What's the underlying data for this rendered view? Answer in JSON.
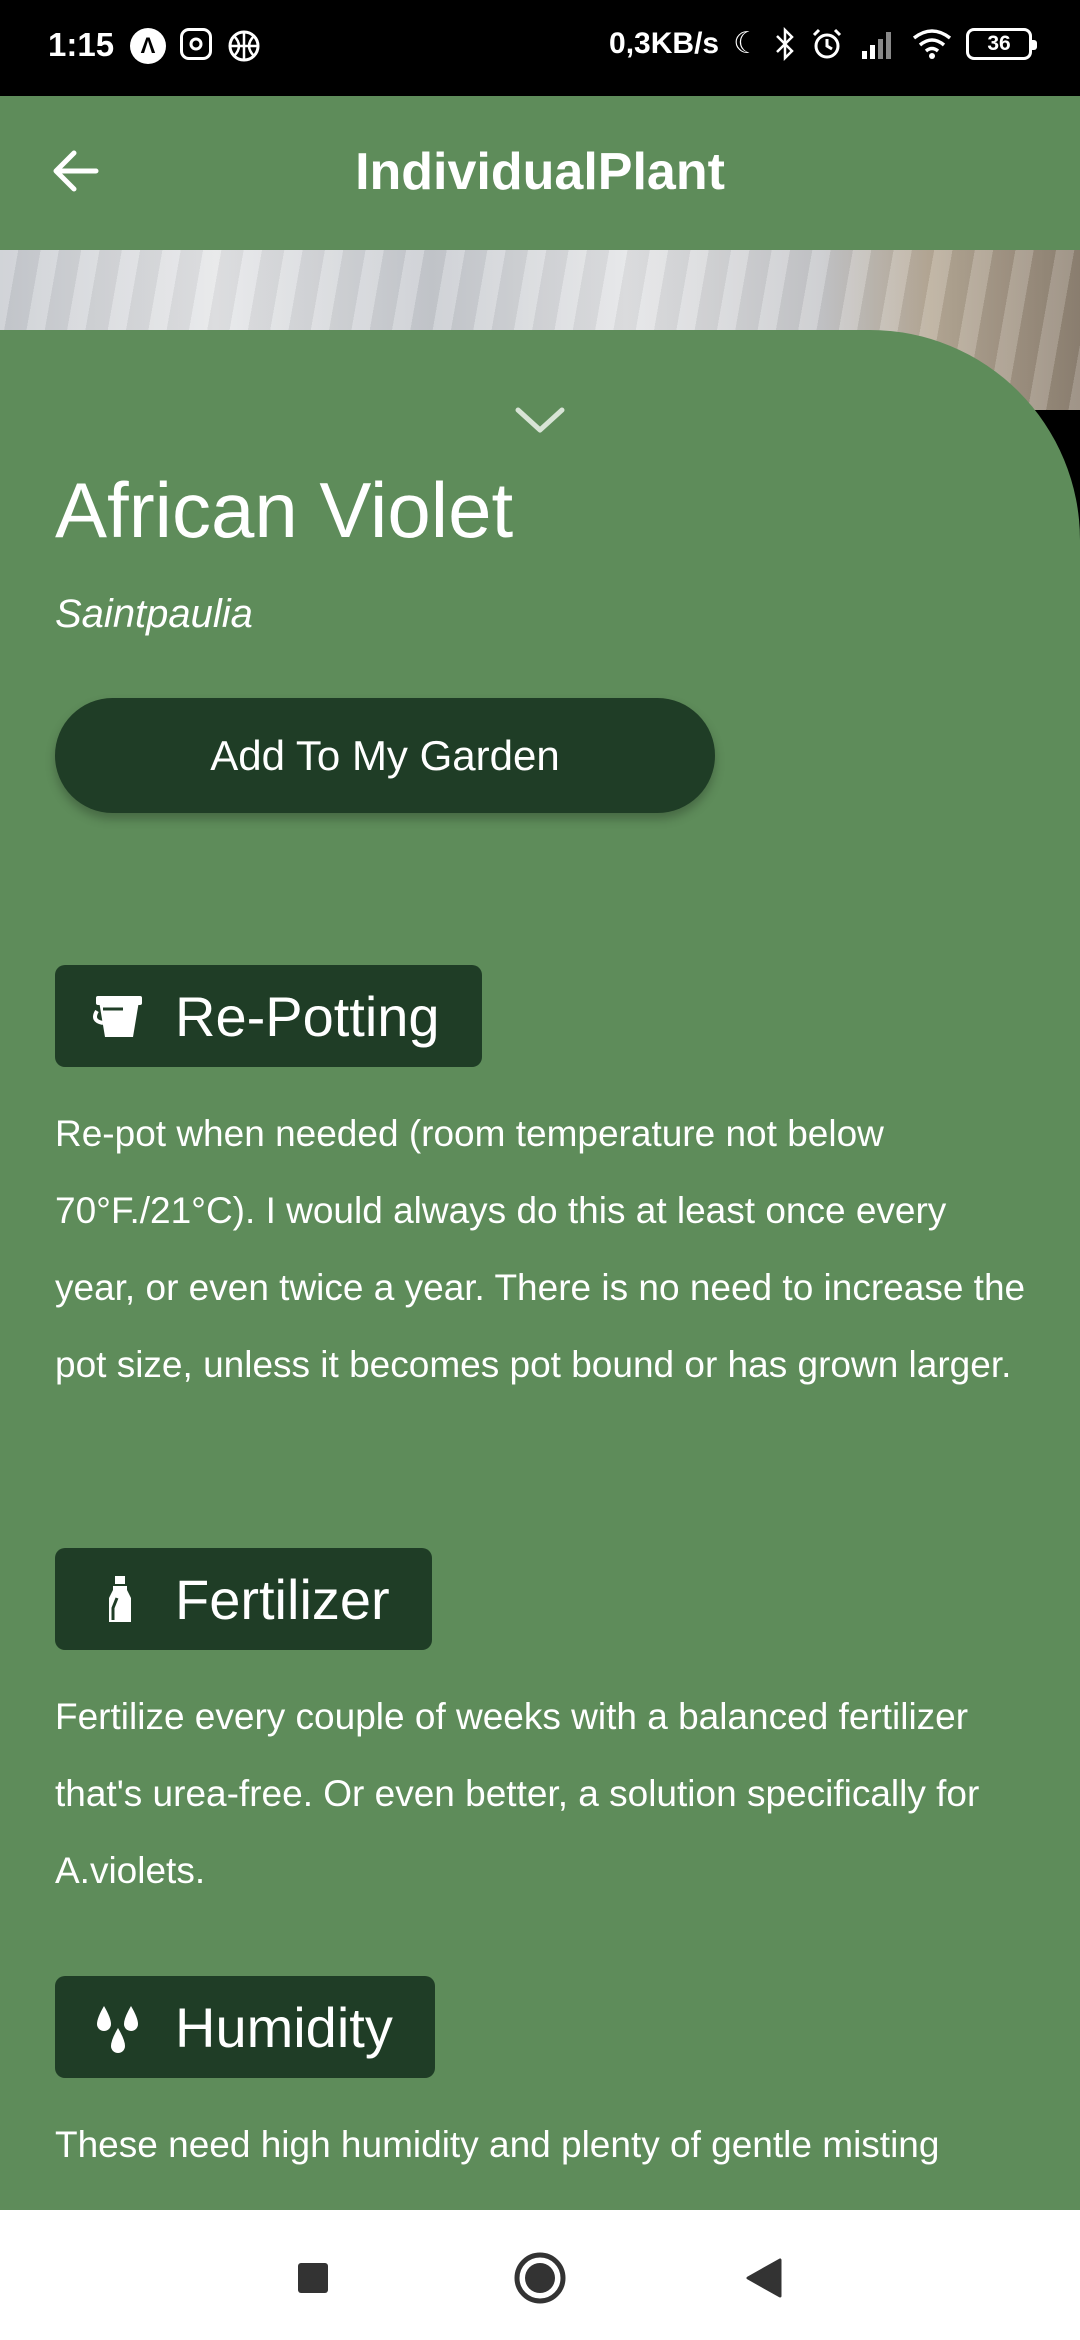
{
  "status_bar": {
    "time": "1:15",
    "left_icons": [
      "app-a-icon",
      "instagram-icon",
      "basketball-icon"
    ],
    "net_speed": "0,3KB/s",
    "right_icons": [
      "moon-icon",
      "bluetooth-icon",
      "alarm-icon",
      "signal-icon",
      "wifi-icon"
    ],
    "battery": "36"
  },
  "app_bar": {
    "title": "IndividualPlant",
    "back_icon": "arrow-left-icon"
  },
  "plant": {
    "name": "African Violet",
    "scientific_name": "Saintpaulia",
    "add_button": "Add To My Garden"
  },
  "sections": [
    {
      "icon": "pot-icon",
      "title": "Re-Potting",
      "text": "Re-pot when needed (room temperature not below 70°F./21°C). I would always do this at least once every year, or even twice a year. There is no need to increase the pot size, unless it becomes pot bound or has grown larger."
    },
    {
      "icon": "spray-bottle-icon",
      "title": "Fertilizer",
      "text": "Fertilize every couple of weeks with a balanced fertilizer that's urea-free. Or even better, a solution specifically for A.violets."
    },
    {
      "icon": "water-drops-icon",
      "title": "Humidity",
      "text": "These need high humidity and plenty of gentle misting"
    }
  ],
  "colors": {
    "primary": "#5e8c5a",
    "dark": "#1f3d26"
  },
  "nav_bar": [
    "square-recents-icon",
    "circle-home-icon",
    "triangle-back-icon"
  ]
}
